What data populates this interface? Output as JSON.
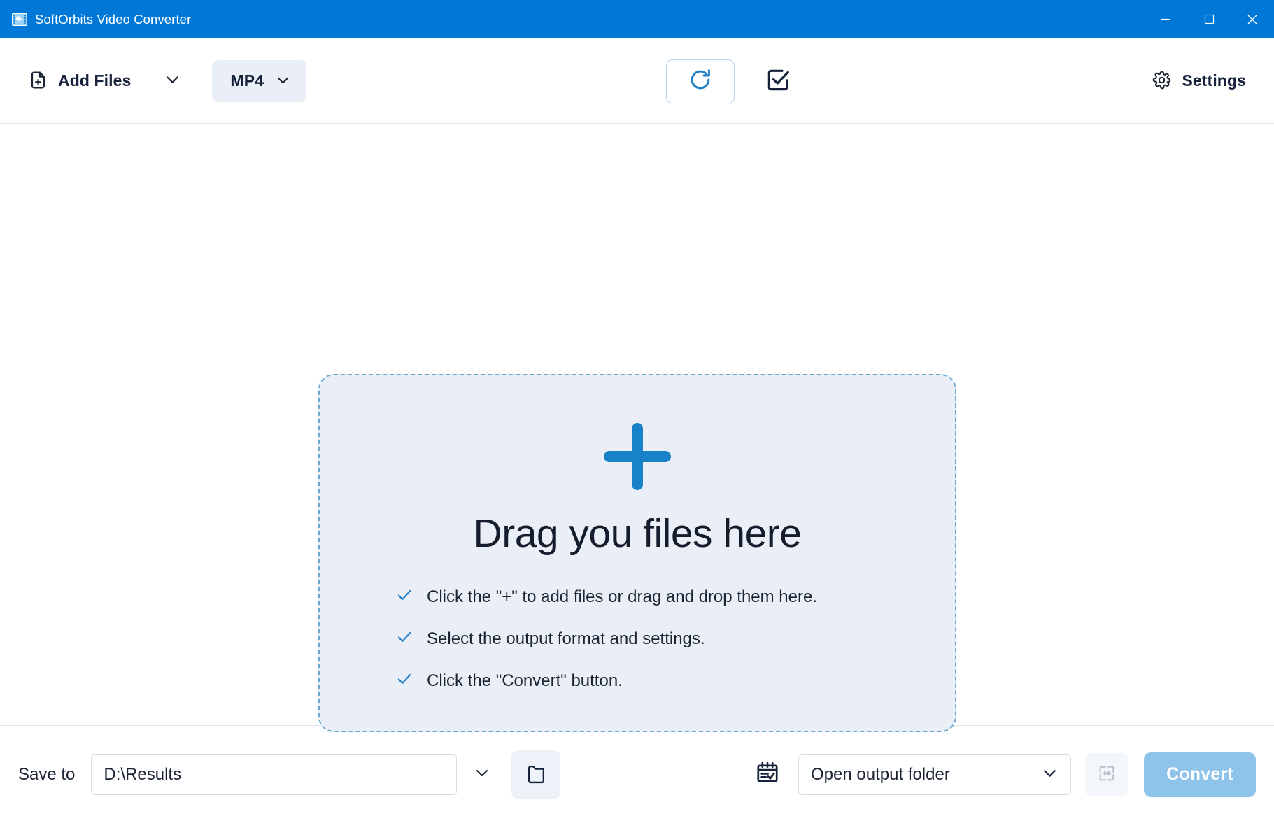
{
  "window": {
    "title": "SoftOrbits Video Converter",
    "app_icon": "film-reel-icon",
    "accent_color": "#0078d7",
    "controls": {
      "minimize": "minimize-icon",
      "maximize": "maximize-icon",
      "close": "close-icon"
    }
  },
  "toolbar": {
    "add_files_label": "Add Files",
    "add_files_icon": "file-plus-icon",
    "add_files_caret_icon": "chevron-down-icon",
    "format_label": "MP4",
    "format_caret_icon": "chevron-down-icon",
    "refresh_icon": "refresh-icon",
    "select_all_icon": "checkbox-checked-icon",
    "settings_label": "Settings",
    "settings_icon": "gear-icon"
  },
  "dropzone": {
    "plus_icon": "plus-icon",
    "plus_color": "#1782c8",
    "title": "Drag you files here",
    "background": "#eaeff7",
    "border_color": "#6aa9cf",
    "items": [
      {
        "icon": "check-icon",
        "text": "Click the \"+\" to add files or drag and drop them here."
      },
      {
        "icon": "check-icon",
        "text": "Select the output format and settings."
      },
      {
        "icon": "check-icon",
        "text": "Click the \"Convert\" button."
      }
    ]
  },
  "footer": {
    "save_to_label": "Save to",
    "path_value": "D:\\Results",
    "path_placeholder": "D:\\Results",
    "path_caret_icon": "chevron-down-icon",
    "folder_icon": "folder-icon",
    "calendar_icon": "calendar-check-icon",
    "after_action_value": "Open output folder",
    "after_action_caret_icon": "chevron-down-icon",
    "merge_icon": "merge-icon",
    "convert_label": "Convert",
    "convert_color": "#8ec3ea"
  }
}
